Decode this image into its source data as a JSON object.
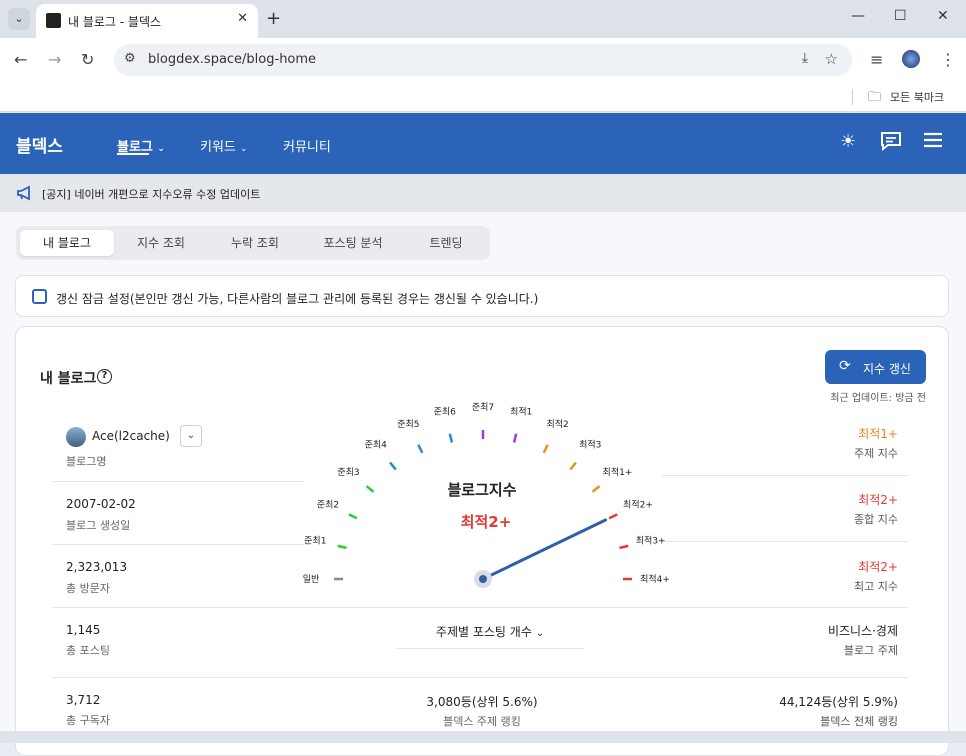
{
  "browser": {
    "tab_title": "내 블로그 - 블덱스",
    "url": "blogdex.space/blog-home",
    "bookmark_folder": "모든 북마크"
  },
  "site": {
    "logo": "블덱스",
    "nav": [
      {
        "label": "블로그",
        "has_dropdown": true,
        "active": true
      },
      {
        "label": "키워드",
        "has_dropdown": true,
        "active": false
      },
      {
        "label": "커뮤니티",
        "has_dropdown": false,
        "active": false
      }
    ],
    "header_icons": [
      "sun-icon",
      "chat-icon",
      "menu-icon"
    ],
    "accent_color": "#2a63b8"
  },
  "notice": {
    "text": "[공지] 네이버 개편으로 지수오류 수정 업데이트"
  },
  "subtabs": [
    {
      "label": "내 블로그",
      "active": true
    },
    {
      "label": "지수 조회",
      "active": false
    },
    {
      "label": "누락 조회",
      "active": false
    },
    {
      "label": "포스팅 분석",
      "active": false
    },
    {
      "label": "트렌딩",
      "active": false
    }
  ],
  "lock_setting": {
    "checked": false,
    "label": "갱신 잠금 설정(본인만 갱신 가능, 다른사람의 블로그 관리에 등록된 경우는 갱신될 수 있습니다.)"
  },
  "card": {
    "title": "내 블로그",
    "refresh_label": "지수 갱신",
    "updated": "최근 업데이트:  방금 전"
  },
  "left_stats": [
    {
      "value": "Ace(l2cache)",
      "label": "블로그명"
    },
    {
      "value": "2007-02-02",
      "label": "블로그 생성일"
    },
    {
      "value": "2,323,013",
      "label": "총 방문자"
    },
    {
      "value": "1,145",
      "label": "총 포스팅"
    },
    {
      "value": "3,712",
      "label": "총 구독자"
    }
  ],
  "right_stats": [
    {
      "value": "최적1+",
      "label": "주제 지수",
      "color": "#e08a1e"
    },
    {
      "value": "최적2+",
      "label": "종합 지수",
      "color": "#e53935"
    },
    {
      "value": "최적2+",
      "label": "최고 지수",
      "color": "#e53935"
    },
    {
      "value": "비즈니스·경제",
      "label": "블로그 주제",
      "color": "#222222"
    },
    {
      "value": "44,124등(상위 5.9%)",
      "label": "블덱스 전체 랭킹",
      "color": "#222222"
    }
  ],
  "center_stats": {
    "topic_select": "주제별 포스팅 개수",
    "rank_value": "3,080등(상위 5.6%)",
    "rank_label": "블덱스 주제 랭킹"
  },
  "gauge": {
    "title": "블로그지수",
    "value": "최적2+",
    "value_color": "#e53935",
    "needle_level": "최적2+",
    "levels": [
      {
        "label": "일반",
        "color": "#888888"
      },
      {
        "label": "준최1",
        "color": "#2ecc40"
      },
      {
        "label": "준최2",
        "color": "#2ecc40"
      },
      {
        "label": "준최3",
        "color": "#2ecc40"
      },
      {
        "label": "준최4",
        "color": "#2b8cc4"
      },
      {
        "label": "준최5",
        "color": "#2b8cc4"
      },
      {
        "label": "준최6",
        "color": "#2b8cc4"
      },
      {
        "label": "준최7",
        "color": "#9b3fd1"
      },
      {
        "label": "최적1",
        "color": "#9b3fd1"
      },
      {
        "label": "최적2",
        "color": "#e6961e"
      },
      {
        "label": "최적3",
        "color": "#e6961e"
      },
      {
        "label": "최적1+",
        "color": "#e6961e"
      },
      {
        "label": "최적2+",
        "color": "#e53935"
      },
      {
        "label": "최적3+",
        "color": "#e53935"
      },
      {
        "label": "최적4+",
        "color": "#e53935"
      }
    ]
  }
}
